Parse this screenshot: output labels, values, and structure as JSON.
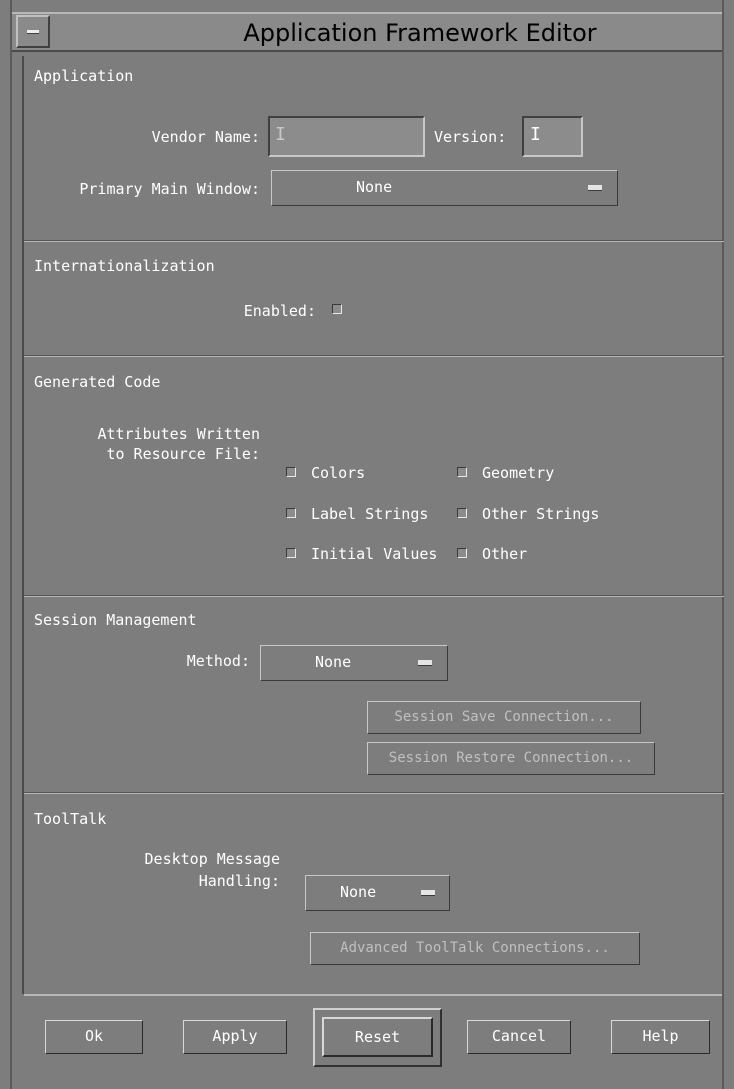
{
  "window": {
    "title": "Application Framework Editor"
  },
  "application": {
    "heading": "Application",
    "vendor_label": "Vendor Name:",
    "vendor_value": "",
    "version_label": "Version:",
    "version_value": "",
    "primary_label": "Primary Main Window:",
    "primary_value": "None"
  },
  "i18n": {
    "heading": "Internationalization",
    "enabled_label": "Enabled:"
  },
  "generated": {
    "heading": "Generated Code",
    "attrs_line1": "Attributes Written",
    "attrs_line2": "to Resource File:",
    "checkboxes": [
      "Colors",
      "Geometry",
      "Label Strings",
      "Other Strings",
      "Initial Values",
      "Other"
    ]
  },
  "session": {
    "heading": "Session Management",
    "method_label": "Method:",
    "method_value": "None",
    "save_button": "Session Save Connection...",
    "restore_button": "Session Restore Connection..."
  },
  "tooltalk": {
    "heading": "ToolTalk",
    "desktop_line1": "Desktop Message",
    "desktop_line2": "Handling:",
    "desktop_value": "None",
    "advanced_button": "Advanced ToolTalk Connections..."
  },
  "buttons": {
    "ok": "Ok",
    "apply": "Apply",
    "reset": "Reset",
    "cancel": "Cancel",
    "help": "Help"
  }
}
